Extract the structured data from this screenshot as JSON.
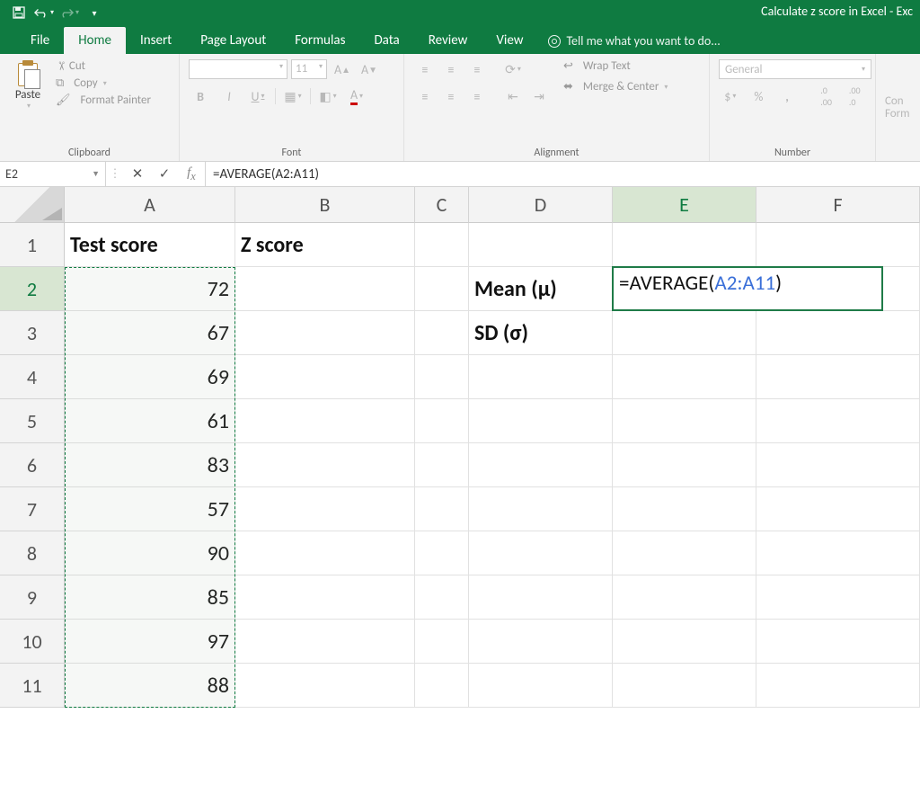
{
  "app": {
    "title": "Calculate z score in Excel - Exc"
  },
  "tabs": {
    "file": "File",
    "home": "Home",
    "insert": "Insert",
    "page_layout": "Page Layout",
    "formulas": "Formulas",
    "data": "Data",
    "review": "Review",
    "view": "View",
    "tellme": "Tell me what you want to do..."
  },
  "ribbon": {
    "clipboard": {
      "label": "Clipboard",
      "paste": "Paste",
      "cut": "Cut",
      "copy": "Copy",
      "format_painter": "Format Painter"
    },
    "font": {
      "label": "Font",
      "name": "",
      "size": "11",
      "bold": "B",
      "italic": "I",
      "underline": "U"
    },
    "alignment": {
      "label": "Alignment",
      "wrap": "Wrap Text",
      "merge": "Merge & Center"
    },
    "number": {
      "label": "Number",
      "format": "General",
      "percent": "%",
      "comma": ",",
      "inc": ".0",
      "dec": ".00"
    },
    "cond": {
      "label": "Con",
      "label2": "Form"
    }
  },
  "namebox": "E2",
  "formula": "=AVERAGE(A2:A11)",
  "columns": [
    "A",
    "B",
    "C",
    "D",
    "E",
    "F"
  ],
  "rows": [
    "1",
    "2",
    "3",
    "4",
    "5",
    "6",
    "7",
    "8",
    "9",
    "10",
    "11"
  ],
  "cells": {
    "A1": "Test score",
    "B1": "Z score",
    "A2": "72",
    "A3": "67",
    "A4": "69",
    "A5": "61",
    "A6": "83",
    "A7": "57",
    "A8": "90",
    "A9": "85",
    "A10": "97",
    "A11": "88",
    "D2": "Mean (μ)",
    "D3": "SD (σ)"
  },
  "editing": {
    "prefix": "=AVERAGE",
    "open": "(",
    "ref": "A2:A11",
    "close": ")"
  },
  "selection_range": "A2:A11",
  "active_cell": "E2",
  "chart_data": {
    "type": "table",
    "headers": [
      "Test score",
      "Z score"
    ],
    "rows": [
      [
        72,
        null
      ],
      [
        67,
        null
      ],
      [
        69,
        null
      ],
      [
        61,
        null
      ],
      [
        83,
        null
      ],
      [
        57,
        null
      ],
      [
        90,
        null
      ],
      [
        85,
        null
      ],
      [
        97,
        null
      ],
      [
        88,
        null
      ]
    ],
    "aux": {
      "Mean (μ)": "=AVERAGE(A2:A11)",
      "SD (σ)": ""
    }
  }
}
